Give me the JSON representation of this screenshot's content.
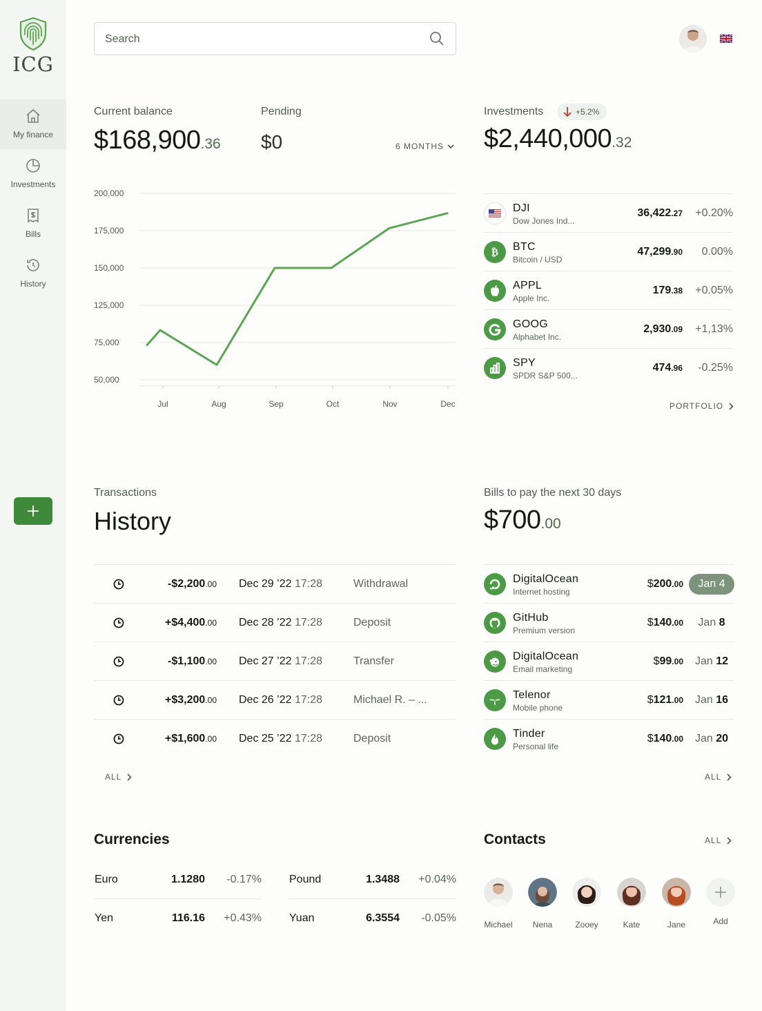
{
  "brand": {
    "name": "ICG",
    "logo_icon": "fingerprint-shield-icon",
    "accent": "#3f8a3a"
  },
  "sidebar": {
    "items": [
      {
        "label": "My finance",
        "icon": "home-icon",
        "active": true
      },
      {
        "label": "Investments",
        "icon": "pie-chart-icon"
      },
      {
        "label": "Bills",
        "icon": "receipt-icon"
      },
      {
        "label": "History",
        "icon": "history-icon"
      }
    ],
    "add_icon": "plus-icon"
  },
  "header": {
    "search_placeholder": "Search",
    "avatar": "user-avatar",
    "language": "uk-flag-icon"
  },
  "balance": {
    "label": "Current balance",
    "amount": "$168,900",
    "cents": ".36",
    "pending_label": "Pending",
    "pending_amount": "$0",
    "period": "6 MONTHS"
  },
  "chart_data": {
    "type": "line",
    "x": [
      "Jul",
      "Aug",
      "Sep",
      "Oct",
      "Nov",
      "Dec"
    ],
    "ytick_labels": [
      "200,000",
      "175,000",
      "150,000",
      "125,000",
      "75,000",
      "50,000"
    ],
    "series": [
      {
        "values": [
          78000,
          90000,
          62000,
          140000,
          140000,
          172000,
          184000
        ],
        "color": "#5aa552"
      }
    ],
    "grid": true
  },
  "investments": {
    "label": "Investments",
    "change": "+5.2%",
    "change_direction": "down",
    "amount": "$2,440,000",
    "cents": ".32",
    "rows": [
      {
        "symbol": "DJI",
        "name": "Dow Jones Ind...",
        "price": "36,422",
        "price_cents": ".27",
        "change": "+0.20%",
        "icon": "us-flag-icon"
      },
      {
        "symbol": "BTC",
        "name": "Bitcoin / USD",
        "price": "47,299",
        "price_cents": ".90",
        "change": "0.00%",
        "icon": "bitcoin-icon"
      },
      {
        "symbol": "APPL",
        "name": "Apple Inc.",
        "price": "179",
        "price_cents": ".38",
        "change": "+0.05%",
        "icon": "apple-icon"
      },
      {
        "symbol": "GOOG",
        "name": "Alphabet Inc.",
        "price": "2,930",
        "price_cents": ".09",
        "change": "+1,13%",
        "icon": "google-icon"
      },
      {
        "symbol": "SPY",
        "name": "SPDR S&P 500...",
        "price": "474",
        "price_cents": ".96",
        "change": "-0.25%",
        "icon": "bar-chart-icon"
      }
    ],
    "portfolio_link": "PORTFOLIO"
  },
  "transactions": {
    "label": "Transactions",
    "title": "History",
    "rows": [
      {
        "amount": "-$2,200",
        "cents": ".00",
        "date": "Dec 29 ’22",
        "time": "17:28",
        "desc": "Withdrawal"
      },
      {
        "amount": "+$4,400",
        "cents": ".00",
        "date": "Dec 28 ’22",
        "time": "17:28",
        "desc": "Deposit"
      },
      {
        "amount": "-$1,100",
        "cents": ".00",
        "date": "Dec 27 ’22",
        "time": "17:28",
        "desc": "Transfer"
      },
      {
        "amount": "+$3,200",
        "cents": ".00",
        "date": "Dec 26 ’22",
        "time": "17:28",
        "desc": "Michael R. – ..."
      },
      {
        "amount": "+$1,600",
        "cents": ".00",
        "date": "Dec 25 ’22",
        "time": "17:28",
        "desc": "Deposit"
      }
    ],
    "all_link": "ALL"
  },
  "bills": {
    "label": "Bills to pay the next 30 days",
    "amount": "$700",
    "cents": ".00",
    "rows": [
      {
        "name": "DigitalOcean",
        "sub": "Internet hosting",
        "dollar": "$",
        "amount": "200",
        "cents": ".00",
        "month": "Jan",
        "day": "4",
        "highlight": true,
        "icon": "digitalocean-icon"
      },
      {
        "name": "GitHub",
        "sub": "Premium version",
        "dollar": "$",
        "amount": "140",
        "cents": ".00",
        "month": "Jan",
        "day": "8",
        "icon": "github-icon"
      },
      {
        "name": "DigitalOcean",
        "sub": "Email marketing",
        "dollar": "$",
        "amount": "99",
        "cents": ".00",
        "month": "Jan",
        "day": "12",
        "icon": "mailchimp-icon"
      },
      {
        "name": "Telenor",
        "sub": "Mobile phone",
        "dollar": "$",
        "amount": "121",
        "cents": ".00",
        "month": "Jan",
        "day": "16",
        "icon": "telenor-icon"
      },
      {
        "name": "Tinder",
        "sub": "Personal life",
        "dollar": "$",
        "amount": "140",
        "cents": ".00",
        "month": "Jan",
        "day": "20",
        "icon": "flame-icon"
      }
    ],
    "all_link": "ALL"
  },
  "currencies": {
    "title": "Currencies",
    "rows": [
      {
        "name": "Euro",
        "value": "1.1280",
        "change": "-0.17%"
      },
      {
        "name": "Pound",
        "value": "1.3488",
        "change": "+0.04%"
      },
      {
        "name": "Yen",
        "value": "116.16",
        "change": "+0.43%"
      },
      {
        "name": "Yuan",
        "value": "6.3554",
        "change": "-0.05%"
      }
    ]
  },
  "contacts": {
    "title": "Contacts",
    "all_link": "ALL",
    "people": [
      {
        "name": "Michael",
        "color": "#d9c2b2"
      },
      {
        "name": "Nena",
        "color": "#6b7f8e"
      },
      {
        "name": "Zooey",
        "color": "#3a2a22"
      },
      {
        "name": "Kate",
        "color": "#7a3e2c"
      },
      {
        "name": "Jane",
        "color": "#b7552c"
      }
    ],
    "add_label": "Add"
  }
}
